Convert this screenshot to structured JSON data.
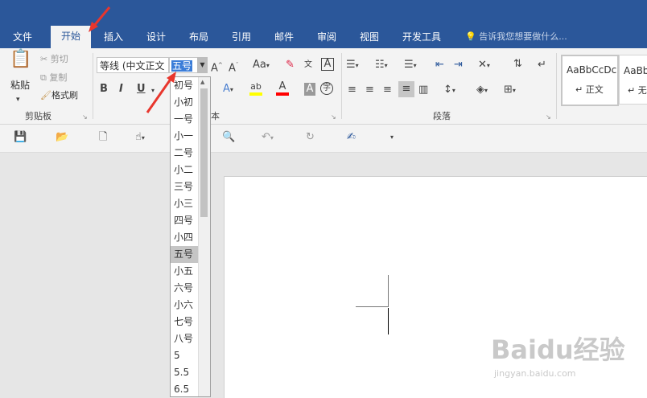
{
  "tabs": [
    "文件",
    "开始",
    "插入",
    "设计",
    "布局",
    "引用",
    "邮件",
    "审阅",
    "视图",
    "开发工具"
  ],
  "tell_me": "告诉我您想要做什么...",
  "clipboard": {
    "paste": "粘贴",
    "cut": "剪切",
    "copy": "复制",
    "format_painter": "格式刷",
    "group_label": "剪贴板"
  },
  "font": {
    "family": "等线 (中文正文",
    "size": "五号",
    "aa_label": "Aa",
    "group_label_partial": "本"
  },
  "paragraph": {
    "group_label": "段落"
  },
  "styles": {
    "sample1": "AaBbCcDc",
    "name1": "正文",
    "sample2": "AaBb",
    "name2": "无"
  },
  "size_list": [
    "初号",
    "小初",
    "一号",
    "小一",
    "二号",
    "小二",
    "三号",
    "小三",
    "四号",
    "小四",
    "五号",
    "小五",
    "六号",
    "小六",
    "七号",
    "八号",
    "5",
    "5.5",
    "6.5"
  ],
  "selected_size": "五号",
  "colors": {
    "title_bar": "#2b579a",
    "ribbon": "#f3f3f3",
    "arrow": "#e8362d",
    "highlight_yellow": "#ffff00",
    "font_red": "#ff0000"
  },
  "watermark": {
    "brand": "Baidu经验",
    "url": "jingyan.baidu.com"
  }
}
